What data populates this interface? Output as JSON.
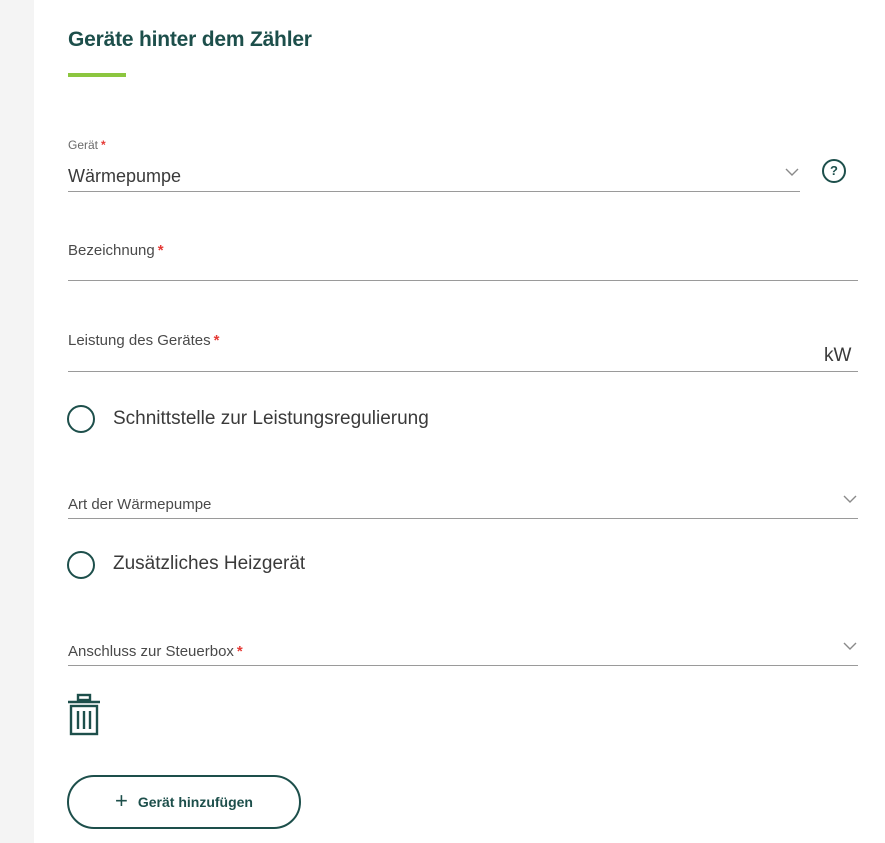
{
  "section": {
    "title": "Geräte hinter dem Zähler"
  },
  "device_select": {
    "label": "Gerät",
    "required_mark": "*",
    "value": "Wärmepumpe",
    "help_icon": "?"
  },
  "designation": {
    "label": "Bezeichnung",
    "required_mark": "*",
    "value": ""
  },
  "power": {
    "label": "Leistung des Gerätes",
    "required_mark": "*",
    "value": "",
    "unit": "kW"
  },
  "power_regulation_interface": {
    "label": "Schnittstelle zur Leistungsregulierung",
    "checked": false
  },
  "heatpump_type": {
    "label": "Art der Wärmepumpe",
    "value": ""
  },
  "additional_heater": {
    "label": "Zusätzliches Heizgerät",
    "checked": false
  },
  "control_box_connection": {
    "label": "Anschluss zur Steuerbox",
    "required_mark": "*",
    "value": ""
  },
  "actions": {
    "delete_icon": "trash-icon",
    "add_device_label": "Gerät hinzufügen",
    "add_icon": "+"
  },
  "colors": {
    "primary": "#1d4f4b",
    "accent": "#8cc63f",
    "required": "#e53935"
  }
}
